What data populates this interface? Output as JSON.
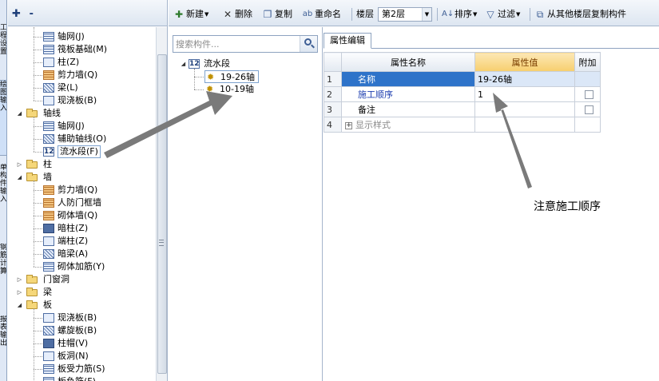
{
  "vertical_tabs": [
    {
      "label": "工程设置",
      "active": false
    },
    {
      "label": "绘图输入",
      "active": true
    },
    {
      "label": "单构件输入",
      "active": false
    },
    {
      "label": "钢筋计算",
      "active": false
    },
    {
      "label": "报表输出",
      "active": false
    }
  ],
  "toolbar": {
    "new_label": "新建",
    "delete_label": "删除",
    "copy_label": "复制",
    "rename_label": "重命名",
    "floor_label": "楼层",
    "floor_value": "第2层",
    "sort_label": "排序",
    "filter_label": "过滤",
    "copy_from_floor_label": "从其他楼层复制构件"
  },
  "left_tree": {
    "items": [
      {
        "label": "轴网(J)",
        "level": 2,
        "icon": "grid-icon"
      },
      {
        "label": "筏板基础(M)",
        "level": 2,
        "icon": "raft-foundation-icon"
      },
      {
        "label": "柱(Z)",
        "level": 2,
        "icon": "column-icon"
      },
      {
        "label": "剪力墙(Q)",
        "level": 2,
        "icon": "shear-wall-icon"
      },
      {
        "label": "梁(L)",
        "level": 2,
        "icon": "beam-icon"
      },
      {
        "label": "现浇板(B)",
        "level": 2,
        "icon": "slab-icon"
      },
      {
        "label": "轴线",
        "level": 1,
        "icon": "folder-open-icon",
        "expanded": true
      },
      {
        "label": "轴网(J)",
        "level": 2,
        "icon": "grid-icon"
      },
      {
        "label": "辅助轴线(O)",
        "level": 2,
        "icon": "auxiliary-axis-icon"
      },
      {
        "label": "流水段(F)",
        "level": 2,
        "icon": "flow-section-icon",
        "selected": true
      },
      {
        "label": "柱",
        "level": 1,
        "icon": "folder-icon",
        "expanded": false
      },
      {
        "label": "墙",
        "level": 1,
        "icon": "folder-open-icon",
        "expanded": true
      },
      {
        "label": "剪力墙(Q)",
        "level": 2,
        "icon": "shear-wall-icon"
      },
      {
        "label": "人防门框墙",
        "level": 2,
        "icon": "civil-defense-door-wall-icon"
      },
      {
        "label": "砌体墙(Q)",
        "level": 2,
        "icon": "masonry-wall-icon"
      },
      {
        "label": "暗柱(Z)",
        "level": 2,
        "icon": "hidden-column-icon"
      },
      {
        "label": "端柱(Z)",
        "level": 2,
        "icon": "end-column-icon"
      },
      {
        "label": "暗梁(A)",
        "level": 2,
        "icon": "hidden-beam-icon"
      },
      {
        "label": "砌体加筋(Y)",
        "level": 2,
        "icon": "masonry-reinforcement-icon"
      },
      {
        "label": "门窗洞",
        "level": 1,
        "icon": "folder-icon",
        "expanded": false
      },
      {
        "label": "梁",
        "level": 1,
        "icon": "folder-icon",
        "expanded": false
      },
      {
        "label": "板",
        "level": 1,
        "icon": "folder-open-icon",
        "expanded": true
      },
      {
        "label": "现浇板(B)",
        "level": 2,
        "icon": "slab-icon"
      },
      {
        "label": "螺旋板(B)",
        "level": 2,
        "icon": "spiral-slab-icon"
      },
      {
        "label": "柱帽(V)",
        "level": 2,
        "icon": "column-cap-icon"
      },
      {
        "label": "板洞(N)",
        "level": 2,
        "icon": "slab-hole-icon"
      },
      {
        "label": "板受力筋(S)",
        "level": 2,
        "icon": "slab-stress-rebar-icon"
      },
      {
        "label": "板负筋(F)",
        "level": 2,
        "icon": "slab-negative-rebar-icon"
      }
    ]
  },
  "search": {
    "placeholder": "搜索构件..."
  },
  "mid_tree": {
    "root_label": "流水段",
    "children": [
      {
        "label": "19-26轴",
        "selected": true
      },
      {
        "label": "10-19轴",
        "selected": false
      }
    ]
  },
  "properties": {
    "tab_label": "属性编辑",
    "headers": {
      "name": "属性名称",
      "value": "属性值",
      "extra": "附加"
    },
    "rows": [
      {
        "num": "1",
        "name": "名称",
        "value": "19-26轴",
        "checkbox": false
      },
      {
        "num": "2",
        "name": "施工顺序",
        "value": "1",
        "checkbox": true
      },
      {
        "num": "3",
        "name": "备注",
        "value": "",
        "checkbox": true
      },
      {
        "num": "4",
        "name": "显示样式",
        "value": "",
        "checkbox": false,
        "expandable": true
      }
    ]
  },
  "annotation": {
    "text": "注意施工顺序"
  },
  "colors": {
    "accent": "#2e73c9",
    "header_highlight": "#f7cf6e",
    "arrow": "#7a7a7a"
  }
}
